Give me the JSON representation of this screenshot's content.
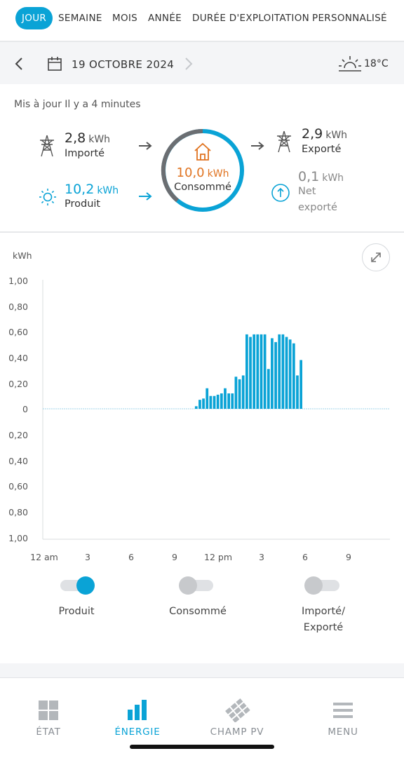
{
  "tabs": [
    "JOUR",
    "SEMAINE",
    "MOIS",
    "ANNÉE",
    "DURÉE D'EXPLOITATION",
    "PERSONNALISÉ"
  ],
  "date": "19 OCTOBRE 2024",
  "temperature": "18°C",
  "updated": "Mis à jour Il y a 4 minutes",
  "imported": {
    "value": "2,8",
    "unit": "kWh",
    "label": "Importé"
  },
  "produced": {
    "value": "10,2",
    "unit": "kWh",
    "label": "Produit"
  },
  "consumed": {
    "value": "10,0",
    "unit": "kWh",
    "label": "Consommé"
  },
  "exported": {
    "value": "2,9",
    "unit": "kWh",
    "label": "Exporté"
  },
  "net_exported": {
    "value": "0,1",
    "unit": "kWh",
    "label_line1": "Net",
    "label_line2": "exporté"
  },
  "chart": {
    "unit_label": "kWh",
    "y_ticks": [
      "1,00",
      "0,80",
      "0,60",
      "0,40",
      "0,20",
      "0",
      "0,20",
      "0,40",
      "0,60",
      "0,80",
      "1,00"
    ],
    "x_ticks": [
      "12 am",
      "3",
      "6",
      "9",
      "12 pm",
      "3",
      "6",
      "9"
    ],
    "bar_color": "#0aa3d6"
  },
  "chart_data": {
    "type": "bar",
    "title": "",
    "xlabel": "",
    "ylabel": "kWh",
    "ylim": [
      -1,
      1
    ],
    "series": [
      {
        "name": "Produit",
        "values": [
          0.0,
          0.0,
          0.0,
          0.0,
          0.0,
          0.0,
          0.0,
          0.0,
          0.0,
          0.0,
          0.0,
          0.0,
          0.0,
          0.0,
          0.0,
          0.0,
          0.0,
          0.0,
          0.0,
          0.0,
          0.0,
          0.0,
          0.0,
          0.0,
          0.0,
          0.0,
          0.0,
          0.0,
          0.0,
          0.0,
          0.0,
          0.0,
          0.0,
          0.0,
          0.0,
          0.0,
          0.0,
          0.0,
          0.0,
          0.0,
          0.0,
          0.0,
          0.02,
          0.07,
          0.08,
          0.16,
          0.1,
          0.1,
          0.11,
          0.12,
          0.16,
          0.12,
          0.12,
          0.25,
          0.23,
          0.26,
          0.58,
          0.56,
          0.58,
          0.58,
          0.58,
          0.58,
          0.31,
          0.55,
          0.52,
          0.58,
          0.58,
          0.56,
          0.54,
          0.51,
          0.26,
          0.38
        ]
      }
    ],
    "interval_minutes": 15,
    "start": "12 am"
  },
  "toggles": [
    {
      "label_line1": "Produit",
      "label_line2": "",
      "on": true
    },
    {
      "label_line1": "Consommé",
      "label_line2": "",
      "on": false
    },
    {
      "label_line1": "Importé/",
      "label_line2": "Exporté",
      "on": false
    }
  ],
  "nav": [
    "ÉTAT",
    "ÉNERGIE",
    "CHAMP PV",
    "MENU"
  ],
  "colors": {
    "accent": "#0aa3d6",
    "consumed": "#e07320",
    "inactive": "#8a8f95"
  }
}
